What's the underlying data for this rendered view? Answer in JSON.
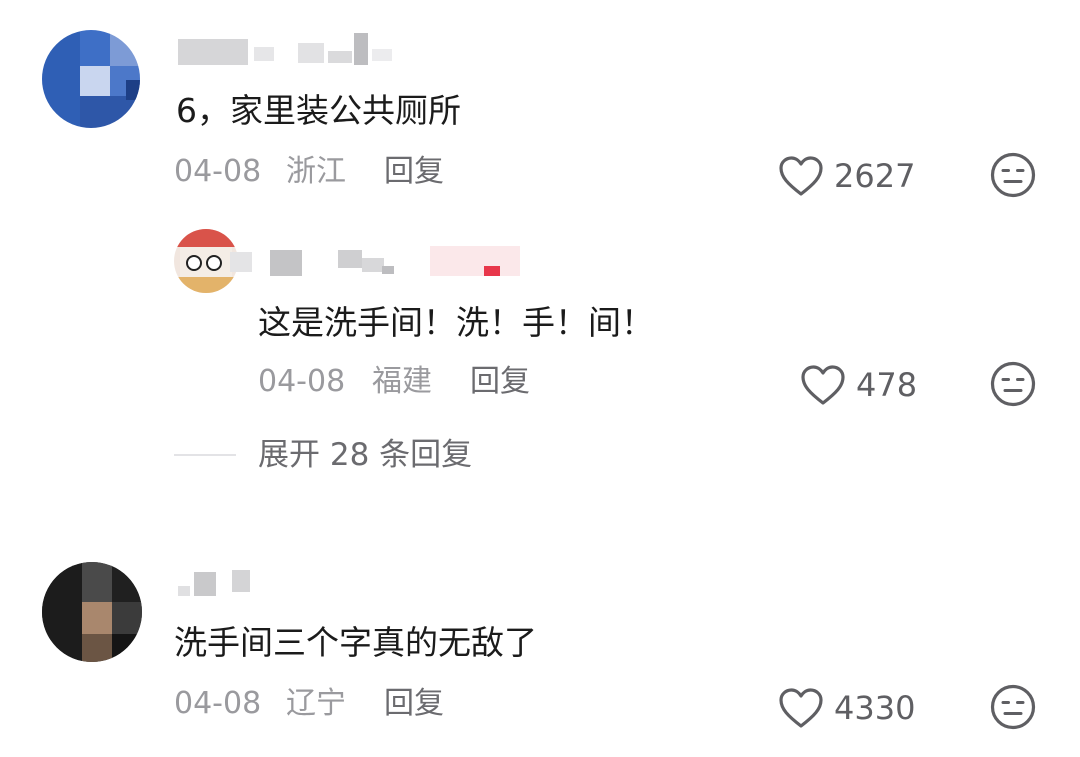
{
  "comments": [
    {
      "text": "6，家里装公共厕所",
      "date": "04-08",
      "location": "浙江",
      "reply_label": "回复",
      "likes": "2627",
      "replies": [
        {
          "text": "这是洗手间！洗！手！间！",
          "date": "04-08",
          "location": "福建",
          "reply_label": "回复",
          "likes": "478"
        }
      ],
      "expand_label": "展开 28 条回复"
    },
    {
      "text": "洗手间三个字真的无敌了",
      "date": "04-08",
      "location": "辽宁",
      "reply_label": "回复",
      "likes": "4330"
    }
  ],
  "icons": {
    "like": "heart-outline-icon",
    "dislike": "meh-face-icon"
  },
  "colors": {
    "text": "#1b1b1b",
    "meta": "#9a9a9e",
    "reply": "#6b6b6f",
    "icon": "#5f5f63"
  }
}
